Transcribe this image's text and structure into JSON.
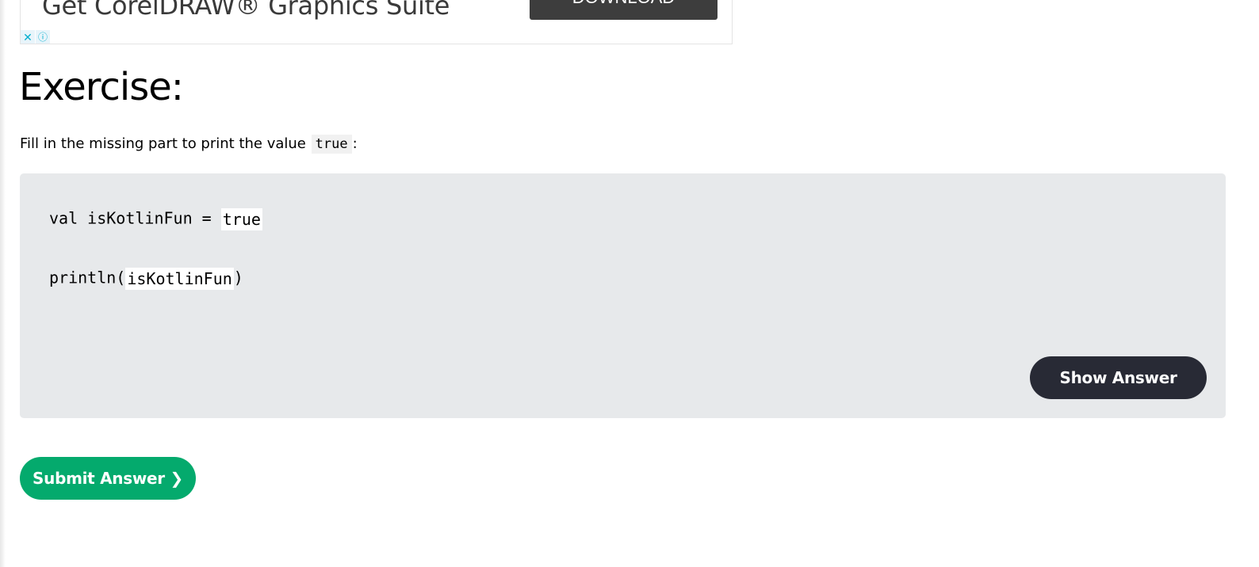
{
  "ad": {
    "headline": "Get CorelDRAW® Graphics Suite",
    "cta_label": "DOWNLOAD",
    "close_glyph": "✕",
    "info_glyph": "ⓘ"
  },
  "exercise": {
    "heading": "Exercise:",
    "instruction_before": "Fill in the missing part to print the value ",
    "instruction_code": "true",
    "instruction_after": ":",
    "code": {
      "line1_prefix": "val isKotlinFun = ",
      "line1_blank": "true",
      "line2_prefix": "println(",
      "line2_blank": "isKotlinFun",
      "line2_suffix": ")"
    },
    "show_answer_label": "Show Answer",
    "submit_label": "Submit Answer ❯"
  },
  "colors": {
    "code_bg": "#e7e9eb",
    "show_answer_bg": "#282a35",
    "submit_bg": "#04aa6d"
  }
}
